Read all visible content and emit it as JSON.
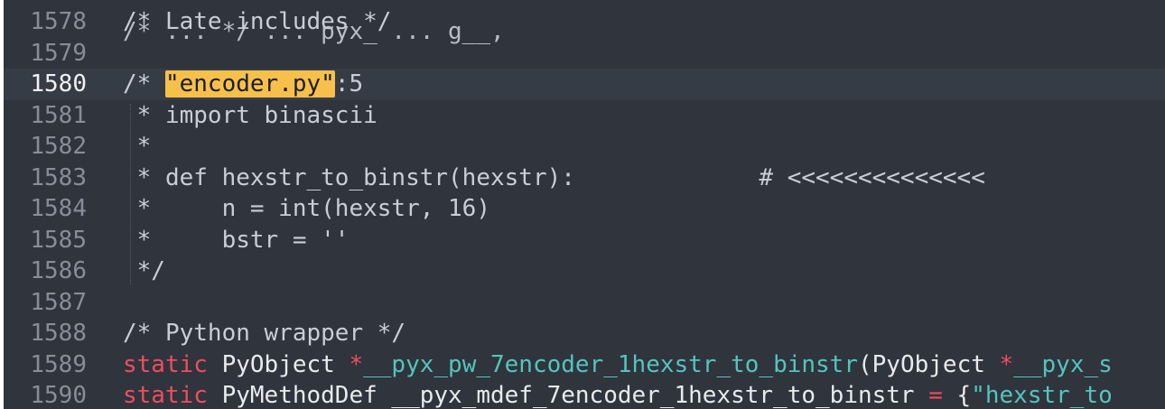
{
  "colors": {
    "background": "#2f343d",
    "current_line": "#363c46",
    "search_highlight": "#f7c04a",
    "keyword": "#ef4d5e",
    "function": "#54c5bd"
  },
  "editor": {
    "cut_off_top": "/* ... */ ... pyx_ ... g__,",
    "lines": [
      {
        "num": "1578",
        "text": "/* Late includes */"
      },
      {
        "num": "1579",
        "text": ""
      },
      {
        "num": "1580",
        "prefix": "/* ",
        "highlight": "\"encoder.py\"",
        "suffix": ":5",
        "current": true
      },
      {
        "num": "1581",
        "text": " * import binascii"
      },
      {
        "num": "1582",
        "text": " *"
      },
      {
        "num": "1583",
        "text": " * def hexstr_to_binstr(hexstr):             # <<<<<<<<<<<<<<"
      },
      {
        "num": "1584",
        "text": " *     n = int(hexstr, 16)"
      },
      {
        "num": "1585",
        "text": " *     bstr = ''"
      },
      {
        "num": "1586",
        "text": " */"
      },
      {
        "num": "1587",
        "text": ""
      },
      {
        "num": "1588",
        "text": "/* Python wrapper */"
      },
      {
        "num": "1589",
        "tokens": [
          {
            "t": "static",
            "c": "keyword"
          },
          {
            "t": " PyObject ",
            "c": "type"
          },
          {
            "t": "*",
            "c": "star"
          },
          {
            "t": "__pyx_pw_7encoder_1hexstr_to_binstr",
            "c": "func"
          },
          {
            "t": "(PyObject ",
            "c": "type"
          },
          {
            "t": "*",
            "c": "star"
          },
          {
            "t": "__pyx_s",
            "c": "func"
          }
        ]
      },
      {
        "num": "1590",
        "tokens": [
          {
            "t": "static",
            "c": "keyword"
          },
          {
            "t": " PyMethodDef __pyx_mdef_7encoder_1hexstr_to_binstr ",
            "c": "type"
          },
          {
            "t": "=",
            "c": "star"
          },
          {
            "t": " {",
            "c": "type"
          },
          {
            "t": "\"hexstr_to",
            "c": "string"
          }
        ]
      }
    ]
  }
}
